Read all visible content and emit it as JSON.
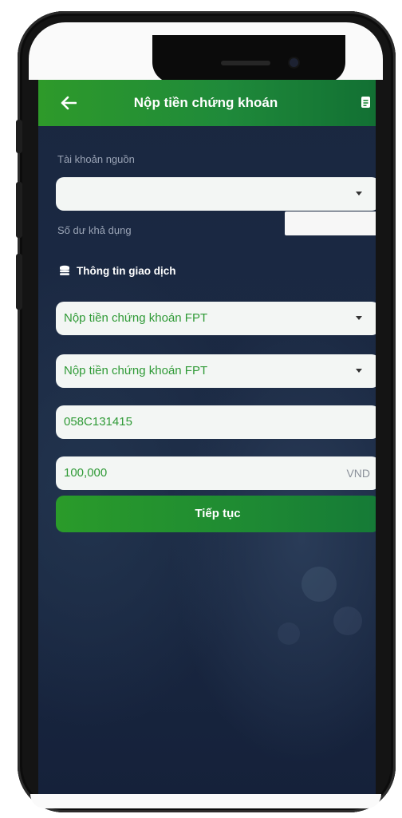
{
  "header": {
    "title": "Nộp tiền chứng khoán",
    "back_icon": "arrow-left-icon",
    "action_icon": "document-icon"
  },
  "source_account": {
    "label": "Tài khoản nguồn",
    "value": ""
  },
  "balance": {
    "label": "Số dư khả dụng",
    "value": ""
  },
  "section": {
    "title": "Thông tin giao dịch",
    "icon": "coins-icon"
  },
  "fields": {
    "service": "Nộp tiền chứng khoán FPT",
    "provider": "Nộp tiền chứng khoán FPT",
    "account_code": "058C131415",
    "amount": "100,000",
    "currency": "VND"
  },
  "continue_button": "Tiếp tục",
  "colors": {
    "accent_green": "#2e9a2a",
    "background_navy": "#1a2740",
    "field_text_green": "#2f9a36"
  }
}
